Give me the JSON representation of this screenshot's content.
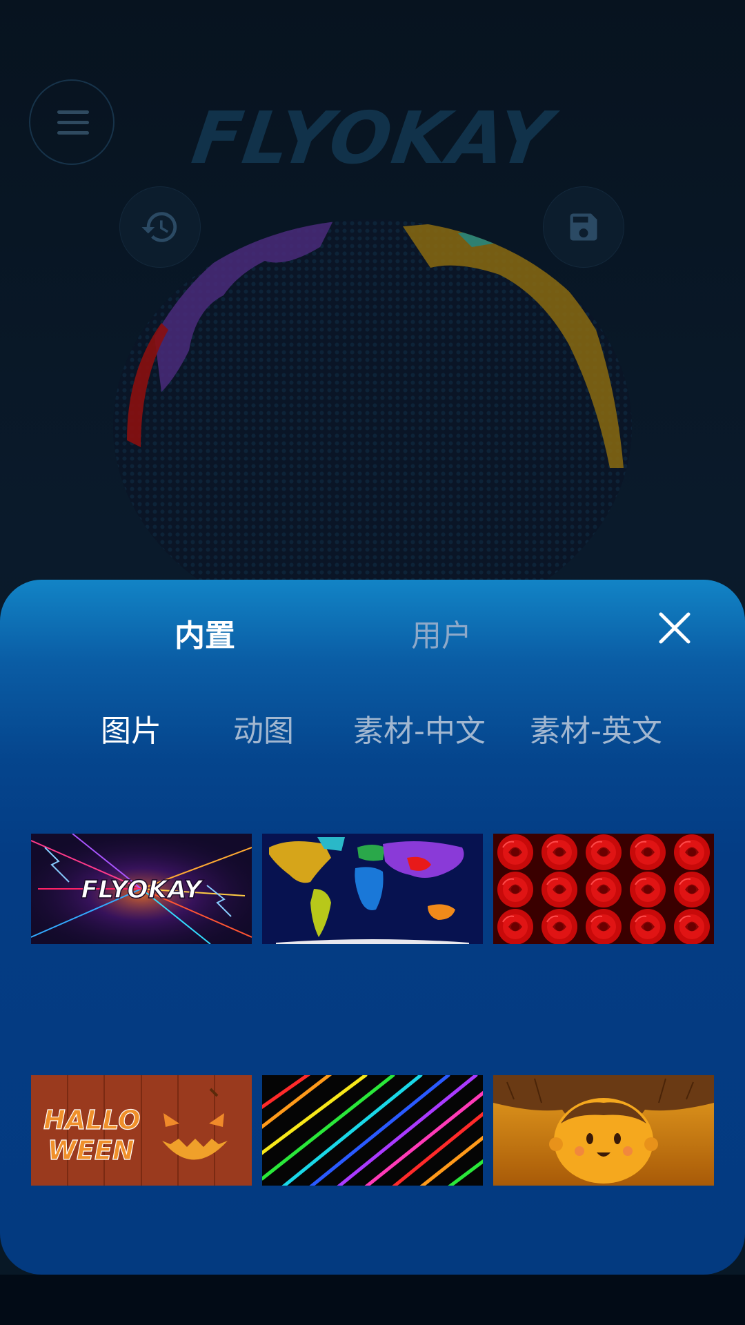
{
  "app": {
    "logo_text": "FLYOKAY"
  },
  "header": {
    "menu_icon": "hamburger-menu-icon",
    "history_icon": "history-icon",
    "save_icon": "save-icon"
  },
  "sheet": {
    "tabs": [
      {
        "label": "内置",
        "selected": true
      },
      {
        "label": "用户",
        "selected": false
      }
    ],
    "close_icon": "close-icon",
    "subtabs": [
      {
        "label": "图片",
        "selected": true
      },
      {
        "label": "动图",
        "selected": false
      },
      {
        "label": "素材-中文",
        "selected": false
      },
      {
        "label": "素材-英文",
        "selected": false
      }
    ],
    "thumbnails": [
      {
        "name": "flyokay-neon-lightning",
        "text": "FLYOKAY"
      },
      {
        "name": "world-map"
      },
      {
        "name": "red-roses"
      },
      {
        "name": "halloween-pumpkin",
        "text_line1": "HALLO",
        "text_line2": "WEEN"
      },
      {
        "name": "rainbow-diagonal-lines"
      },
      {
        "name": "cartoon-kid-face"
      }
    ]
  },
  "colors": {
    "selected_text": "#ffffff",
    "unselected_text": "#a2b7d0",
    "sheet_top": "#1284c6",
    "sheet_bottom": "#033a80"
  }
}
